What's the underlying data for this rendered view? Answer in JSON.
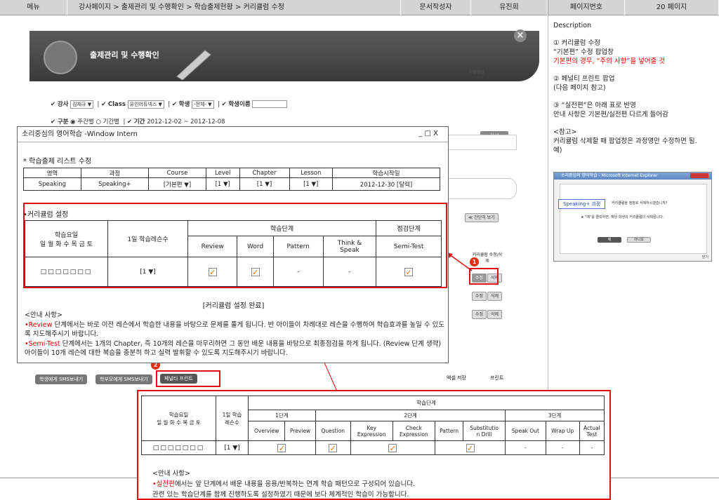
{
  "header": {
    "menu_label": "메뉴",
    "breadcrumb": "강사페이지 > 출제관리 및 수행확인 > 학습출제현황 > 커리큘럼 수정",
    "author_label": "문서작성자",
    "author": "유진희",
    "page_label": "페이지번호",
    "page": "20 페이지"
  },
  "description": {
    "title": "Description",
    "item1_title": "① 커리큘럼 수정",
    "item1_text": "“기본편” 수정 팝업창",
    "item1_red": "기본편의 경우, “주의 사항”을 넣어줄 것",
    "item2_title": "② 페널티 프린트 팝업",
    "item2_text": "(다음 페이지 참고)",
    "item3_title": "③ “실전편”은 아래 표로 반영",
    "item3_text": "안내 사항은 기본편/실전편 다르게 들어감",
    "ref_title": "<참고>",
    "ref_text": "커리큘럼 삭제할 때 팝업창은 과정명만 수정하면 됨.",
    "ref_example": "예)",
    "mini": {
      "bar": "소리중심의 영어학습 - Microsoft Internet Explorer",
      "pill": "Speaking+ 과정",
      "text1": "커리큘럼을 정말로 삭제하시겠습니까?",
      "text2": "★ \"예\"를 클릭하면, 해당 학생의 커리큘럼이 삭제됩니다.",
      "yes": "예",
      "no": "아니오",
      "close": "닫기"
    }
  },
  "background": {
    "banner_title": "출제관리 및 수행확인",
    "help": "? 활용팁",
    "teacher_label": "강사",
    "teacher_value": "김채규",
    "class_label": "Class",
    "class_value": "유인어듀넥스",
    "student_label": "학생",
    "student_value": "-전체-",
    "name_label": "학생이름",
    "type_label": "구분",
    "type_weekly": "주간별",
    "type_period": "기간별",
    "period_label": "기간",
    "period_value": "2012-12-02 ~ 2012-12-08",
    "search": "검색",
    "brief_view": "≪ 간단히 보기",
    "curr_col": "커리큘럼 수정/삭제",
    "edit": "수정",
    "delete": "삭제",
    "btn_sms_student": "학생에게 SMS보내기",
    "btn_sms_parent": "학부모에게 SMS보내기",
    "btn_penalty": "페널티 프린트",
    "excel": "엑셀 저장",
    "print": "프린트"
  },
  "popup": {
    "title": "소리중심의 영어학습 -Window Intern",
    "controls": "_ □ X",
    "section1": "* 학습출제 리스트 수정",
    "t1_headers": [
      "영역",
      "과정",
      "Course",
      "Level",
      "Chapter",
      "Lesson",
      "학습시작일"
    ],
    "t1_row": [
      "Speaking",
      "Speaking+",
      "[기본편 ▼]",
      "[1  ▼]",
      "[1  ▼]",
      "[1  ▼]",
      "2012-12-30 [달력]"
    ],
    "section2": "•커리큘럼 설정",
    "t2_day_header": "학습요일\n일 월 화 수 목 금 토",
    "t2_lessons_header": "1일 학습레슨수",
    "t2_stage": "학습단계",
    "t2_check": "점검단계",
    "t2_cols": [
      "Review",
      "Word",
      "Pattern",
      "Think &\nSpeak",
      "Semi-Test"
    ],
    "t2_days": "□□□□□□□",
    "t2_lessons": "[1  ▼]",
    "t2_dash": "-",
    "complete": "[커리큘럼 설정 완료]",
    "notes_title": "<안내 사항>",
    "note1_red": "•Review",
    "note1": " 단계에서는 바로 이전 레슨에서 학습한 내용을 바탕으로 문제를 풀게 됩니다. 반 아이들이 차례대로 레슨을 수행하여 학습효과를 높일 수 있도록 지도해주시기 바랍니다.",
    "note2_red": "•Semi-Test",
    "note2": " 단계에서는 1개의 Chapter, 즉 10개의 레슨을 마무리하면 그 동안 배운 내용을 바탕으로 최종점검을 하게 됩니다. (Review 단계 생략) 아이들이 10개 레슨에 대한 복습을 충분히 하고 실력 발휘할 수 있도록 지도해주시기 바랍니다."
  },
  "bottom": {
    "day_header": "학습요일\n일 월 화 수 목 금 토",
    "lesson_header": "1일 학습\n레슨수",
    "stage": "학습단계",
    "stage1": "1단계",
    "stage2": "2단계",
    "stage3": "3단계",
    "cols": [
      "Overview",
      "Preview",
      "Question",
      "Key\nExpression",
      "Check\nExpression",
      "Pattern",
      "Substitutio\nn Drill",
      "Speak Out",
      "Wrap Up",
      "Actual\nTest"
    ],
    "days": "□□□□□□□",
    "lessons": "[1  ▼]",
    "dash": "-",
    "notes_title": "<안내 사항>",
    "note_red": "•실전편",
    "note1": "에서는 앞 단계에서 배운 내용을 응용/반복하는 연계 학습 패턴으로 구성되어 있습니다.",
    "note2": "관련 있는 학습단계를 함께 진행하도록 설정하였기 때문에 보다 체계적인 학습이 가능합니다."
  },
  "badges": [
    "1",
    "2"
  ],
  "colors": {
    "accent_red": "#e01010",
    "check_orange": "#e07000"
  }
}
